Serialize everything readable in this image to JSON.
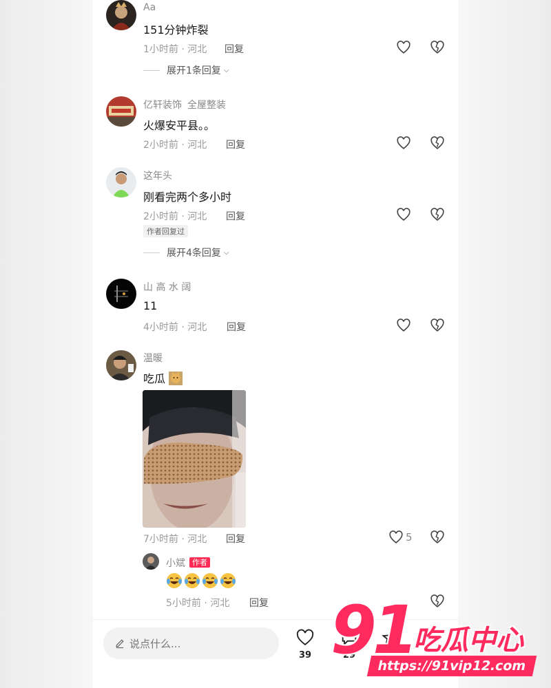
{
  "comments": [
    {
      "username": "Aa",
      "text": "151分钟炸裂",
      "time_loc": "1小时前 · 河北",
      "reply_label": "回复",
      "expand_label": "展开1条回复"
    },
    {
      "username": "亿轩装饰",
      "username_tag": "全屋整装",
      "text": "火爆安平县。。",
      "time_loc": "2小时前 · 河北",
      "reply_label": "回复"
    },
    {
      "username": "这年头",
      "text": "刚看完两个多小时",
      "time_loc": "2小时前 · 河北",
      "reply_label": "回复",
      "author_replied": "作者回复过",
      "expand_label": "展开4条回复"
    },
    {
      "username": "山 高 水 阔",
      "text": "11",
      "time_loc": "4小时前 · 河北",
      "reply_label": "回复"
    },
    {
      "username": "温暖",
      "text": "吃瓜",
      "time_loc": "7小时前 · 河北",
      "reply_label": "回复",
      "like_count": "5"
    }
  ],
  "sub_reply": {
    "username": "小斌",
    "badge": "作者",
    "emoji_name": "laughing-crying-emoji",
    "emoji_count": 4,
    "time_loc": "5小时前 · 河北",
    "reply_label": "回复"
  },
  "bottom_bar": {
    "input_placeholder": "说点什么...",
    "like_count": "39",
    "comment_count": "29"
  },
  "watermark": {
    "logo_number": "91",
    "title": "吃瓜中心",
    "url": "https://91vip12.com"
  },
  "colors": {
    "accent": "#fe2c55",
    "watermark": "#ff2a5e",
    "meta_text": "#9a9a9a"
  },
  "icons": [
    "heart-icon",
    "broken-heart-icon",
    "pencil-icon",
    "chevron-down-icon",
    "comment-bubble-icon",
    "star-icon"
  ]
}
